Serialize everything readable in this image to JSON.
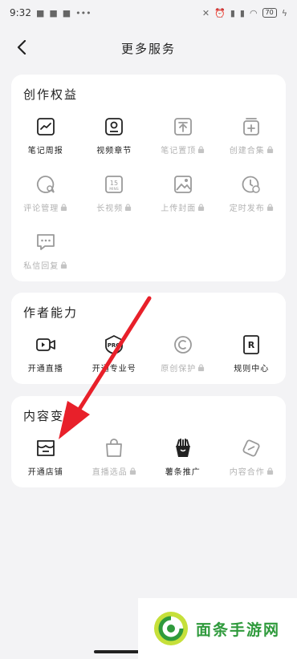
{
  "status_bar": {
    "time": "9:32",
    "battery": "70"
  },
  "header": {
    "title": "更多服务"
  },
  "sections": [
    {
      "title": "创作权益",
      "items": [
        {
          "label": "笔记周报",
          "icon": "weekly-report-icon",
          "locked": false
        },
        {
          "label": "视频章节",
          "icon": "video-chapter-icon",
          "locked": false
        },
        {
          "label": "笔记置顶",
          "icon": "pin-top-icon",
          "locked": true
        },
        {
          "label": "创建合集",
          "icon": "collection-add-icon",
          "locked": true
        },
        {
          "label": "评论管理",
          "icon": "comment-manage-icon",
          "locked": true
        },
        {
          "label": "长视频",
          "icon": "long-video-15min-icon",
          "locked": true
        },
        {
          "label": "上传封面",
          "icon": "upload-cover-icon",
          "locked": true
        },
        {
          "label": "定时发布",
          "icon": "scheduled-publish-icon",
          "locked": true
        },
        {
          "label": "私信回复",
          "icon": "direct-message-icon",
          "locked": true
        }
      ]
    },
    {
      "title": "作者能力",
      "items": [
        {
          "label": "开通直播",
          "icon": "live-camera-icon",
          "locked": false
        },
        {
          "label": "开通专业号",
          "icon": "pro-account-icon",
          "locked": false
        },
        {
          "label": "原创保护",
          "icon": "copyright-icon",
          "locked": true
        },
        {
          "label": "规则中心",
          "icon": "rules-book-icon",
          "locked": false
        }
      ]
    },
    {
      "title": "内容变现",
      "items": [
        {
          "label": "开通店铺",
          "icon": "shop-icon",
          "locked": false
        },
        {
          "label": "直播选品",
          "icon": "shopping-bag-icon",
          "locked": true
        },
        {
          "label": "薯条推广",
          "icon": "fries-promote-icon",
          "locked": false
        },
        {
          "label": "内容合作",
          "icon": "cooperation-icon",
          "locked": true
        }
      ]
    }
  ],
  "watermark": {
    "text": "面条手游网"
  },
  "colors": {
    "accent_arrow": "#e8202a",
    "watermark_green": "#2f9a3c",
    "disabled_text": "#b2b2b2"
  }
}
